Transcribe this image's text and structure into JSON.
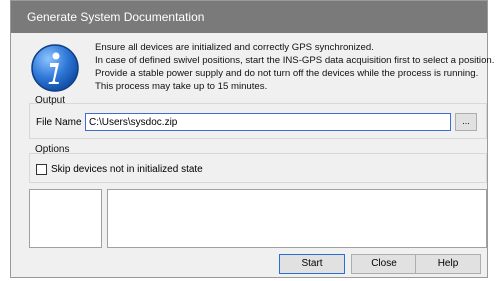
{
  "window": {
    "title": "Generate System Documentation"
  },
  "icons": {
    "info": "info-icon"
  },
  "message": {
    "lines": [
      "Ensure all devices are initialized and correctly GPS synchronized.",
      "In case of defined swivel positions, start the INS-GPS data acquisition first to select a position.",
      "Provide a stable power supply and do not turn off the devices while the process is running.",
      "This process may take up to 15 minutes."
    ]
  },
  "output": {
    "title": "Output",
    "file_label": "File Name",
    "file_value": "C:\\Users\\sysdoc.zip",
    "browse_label": "..."
  },
  "options": {
    "title": "Options",
    "skip_label": "Skip devices not in initialized state",
    "skip_checked": false
  },
  "buttons": {
    "start": "Start",
    "close": "Close",
    "help": "Help"
  }
}
